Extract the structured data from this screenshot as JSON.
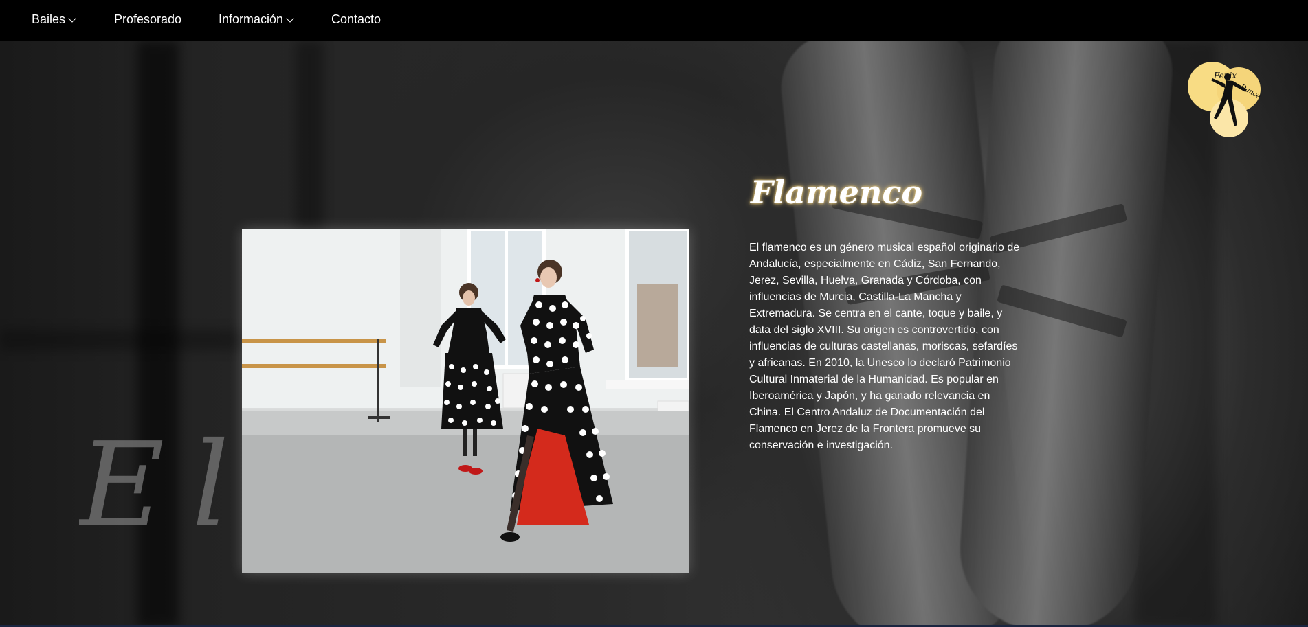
{
  "nav": {
    "items": [
      {
        "label": "Bailes",
        "has_dropdown": true
      },
      {
        "label": "Profesorado",
        "has_dropdown": false
      },
      {
        "label": "Información",
        "has_dropdown": true
      },
      {
        "label": "Contacto",
        "has_dropdown": false
      }
    ]
  },
  "logo": {
    "text": "FenixDance",
    "alt": "Fenix Dance logo"
  },
  "section": {
    "title": "Flamenco",
    "description": "El flamenco es un género musical español originario de Andalucía, especialmente en Cádiz, San Fernando, Jerez, Sevilla, Huelva, Granada y Córdoba, con influencias de Murcia, Castilla-La Mancha y Extremadura. Se centra en el cante, toque y baile, y data del siglo XVIII. Su origen es controvertido, con influencias de culturas castellanas, moriscas, sefardíes y africanas. En 2010, la Unesco lo declaró Patrimonio Cultural Inmaterial de la Humanidad. Es popular en Iberoamérica y Japón, y ha ganado relevancia en China. El Centro Andaluz de Documentación del Flamenco en Jerez de la Frontera promueve su conservación e investigación."
  },
  "slogan": {
    "visible_text": "El a"
  },
  "colors": {
    "nav_bg": "#000000",
    "logo_circle": "#f8dc84",
    "title_glow": "#e8c878",
    "text": "#ffffff"
  }
}
